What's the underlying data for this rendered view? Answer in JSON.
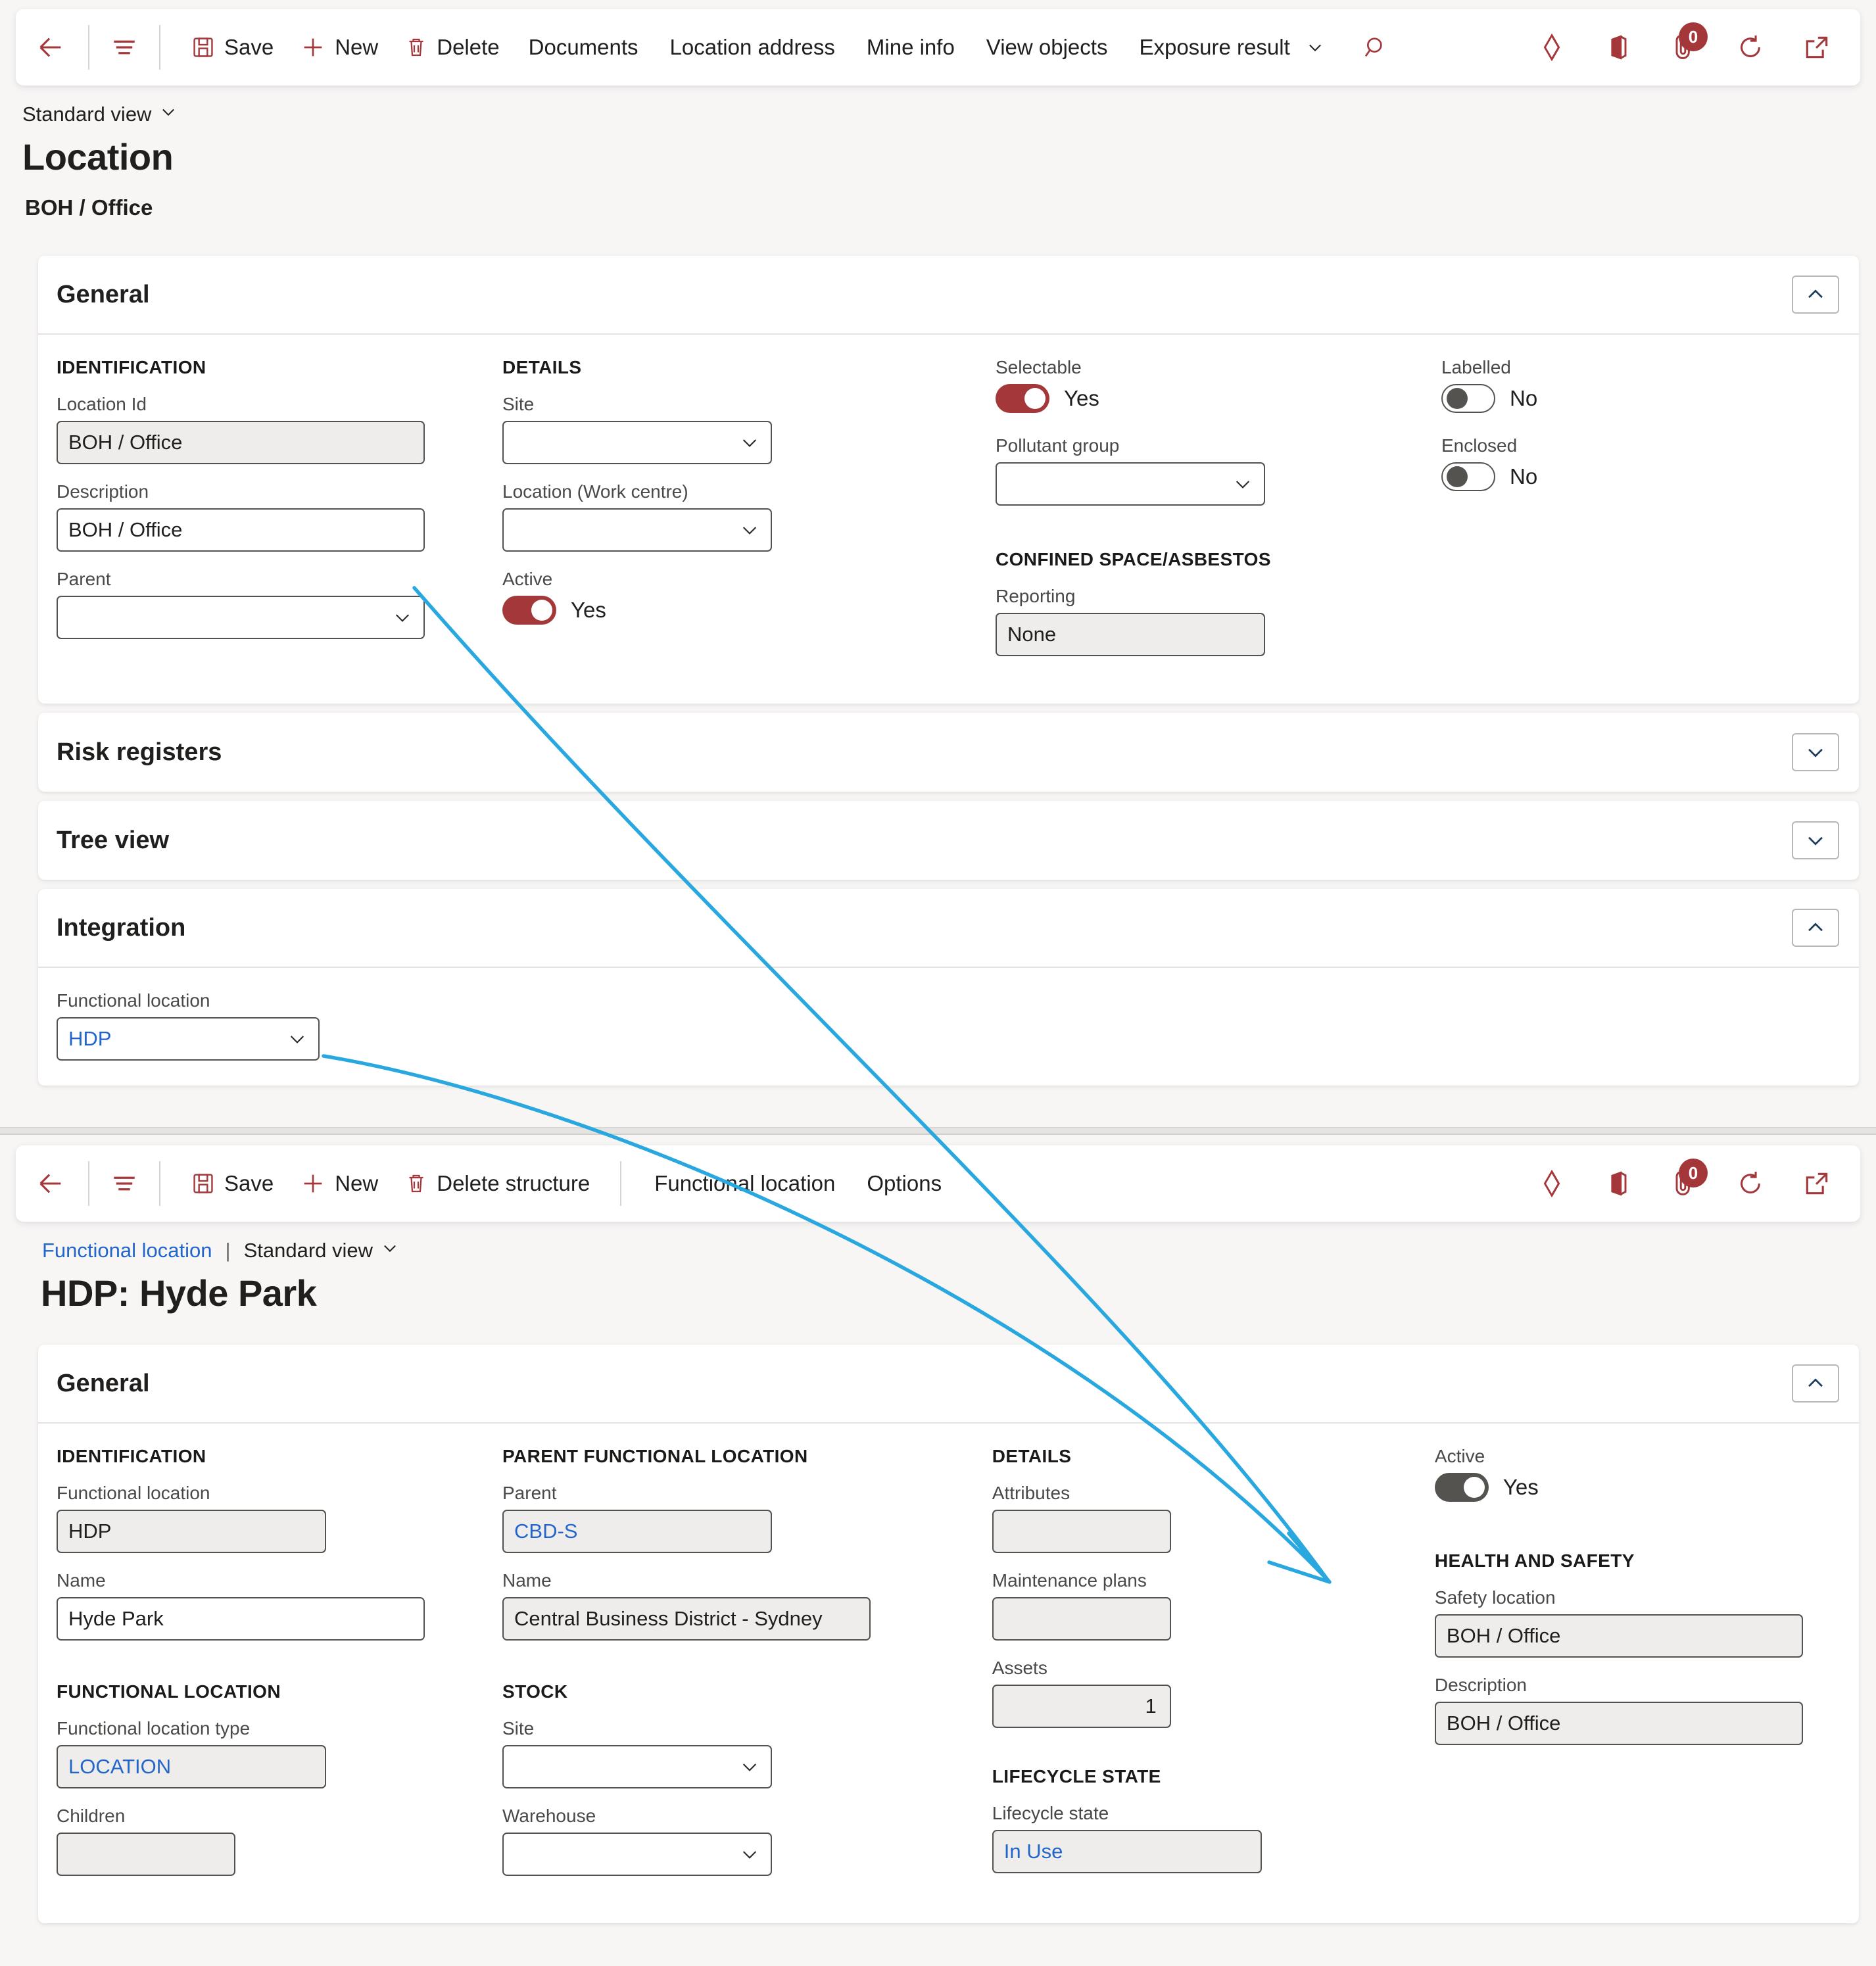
{
  "top_window": {
    "toolbar": {
      "back_icon": "back-arrow-icon",
      "menu_icon": "hamburger-icon",
      "save": "Save",
      "new": "New",
      "delete": "Delete",
      "documents": "Documents",
      "location_address": "Location address",
      "mine_info": "Mine info",
      "view_objects": "View objects",
      "exposure_result": "Exposure result",
      "search_icon": "search-icon",
      "relationships_icon": "relationships-icon",
      "office_icon": "office-app-icon",
      "attachments_icon": "attachment-icon",
      "attachments_badge": "0",
      "refresh_icon": "refresh-icon",
      "popout_icon": "open-in-new-window-icon"
    },
    "view_selector": "Standard view",
    "page_title": "Location",
    "page_subtitle": "BOH / Office",
    "sections": {
      "general": {
        "title": "General",
        "identification": {
          "heading": "IDENTIFICATION",
          "location_id_label": "Location Id",
          "location_id_value": "BOH / Office",
          "description_label": "Description",
          "description_value": "BOH / Office",
          "parent_label": "Parent",
          "parent_value": ""
        },
        "details": {
          "heading": "DETAILS",
          "site_label": "Site",
          "site_value": "",
          "work_centre_label": "Location (Work centre)",
          "work_centre_value": "",
          "active_label": "Active",
          "active_value": "Yes",
          "active_on": true
        },
        "flags": {
          "selectable_label": "Selectable",
          "selectable_value": "Yes",
          "selectable_on": true,
          "pollutant_group_label": "Pollutant group",
          "pollutant_group_value": "",
          "confined_heading": "CONFINED SPACE/ASBESTOS",
          "reporting_label": "Reporting",
          "reporting_value": "None"
        },
        "flags2": {
          "labelled_label": "Labelled",
          "labelled_value": "No",
          "labelled_on": false,
          "enclosed_label": "Enclosed",
          "enclosed_value": "No",
          "enclosed_on": false
        }
      },
      "risk_registers": {
        "title": "Risk registers"
      },
      "tree_view": {
        "title": "Tree view"
      },
      "integration": {
        "title": "Integration",
        "functional_location_label": "Functional location",
        "functional_location_value": "HDP"
      }
    }
  },
  "bottom_window": {
    "toolbar": {
      "back_icon": "back-arrow-icon",
      "menu_icon": "hamburger-icon",
      "save": "Save",
      "new": "New",
      "delete_structure": "Delete structure",
      "functional_location": "Functional location",
      "options": "Options",
      "relationships_icon": "relationships-icon",
      "office_icon": "office-app-icon",
      "attachments_icon": "attachment-icon",
      "attachments_badge": "0",
      "refresh_icon": "refresh-icon",
      "popout_icon": "open-in-new-window-icon"
    },
    "breadcrumb_link": "Functional location",
    "breadcrumb_sep": "|",
    "view_selector": "Standard view",
    "page_title": "HDP: Hyde Park",
    "sections": {
      "general": {
        "title": "General",
        "identification": {
          "heading": "IDENTIFICATION",
          "functional_location_label": "Functional location",
          "functional_location_value": "HDP",
          "name_label": "Name",
          "name_value": "Hyde Park"
        },
        "functional_location_grp": {
          "heading": "FUNCTIONAL LOCATION",
          "type_label": "Functional location type",
          "type_value": "LOCATION",
          "children_label": "Children",
          "children_value": ""
        },
        "parent_functional_location": {
          "heading": "PARENT FUNCTIONAL LOCATION",
          "parent_label": "Parent",
          "parent_value": "CBD-S",
          "name_label": "Name",
          "name_value": "Central Business District - Sydney"
        },
        "stock": {
          "heading": "STOCK",
          "site_label": "Site",
          "site_value": "",
          "warehouse_label": "Warehouse",
          "warehouse_value": ""
        },
        "details": {
          "heading": "DETAILS",
          "attributes_label": "Attributes",
          "attributes_value": "",
          "maintenance_plans_label": "Maintenance plans",
          "maintenance_plans_value": "",
          "assets_label": "Assets",
          "assets_value": "1"
        },
        "lifecycle": {
          "heading": "LIFECYCLE STATE",
          "lifecycle_state_label": "Lifecycle state",
          "lifecycle_state_value": "In Use"
        },
        "right": {
          "active_label": "Active",
          "active_value": "Yes",
          "active_on": true,
          "health_heading": "HEALTH AND SAFETY",
          "safety_location_label": "Safety location",
          "safety_location_value": "BOH / Office",
          "description_label": "Description",
          "description_value": "BOH / Office"
        }
      }
    }
  },
  "annotations": {
    "arrow_color": "#29a8e0",
    "arrow_count": 2
  },
  "colors": {
    "accent": "#a4373a",
    "link": "#2266cc",
    "page_bg": "#f7f6f5",
    "card_bg": "#ffffff",
    "readonly_bg": "#eeedeb",
    "toggle_dark": "#55534f"
  }
}
